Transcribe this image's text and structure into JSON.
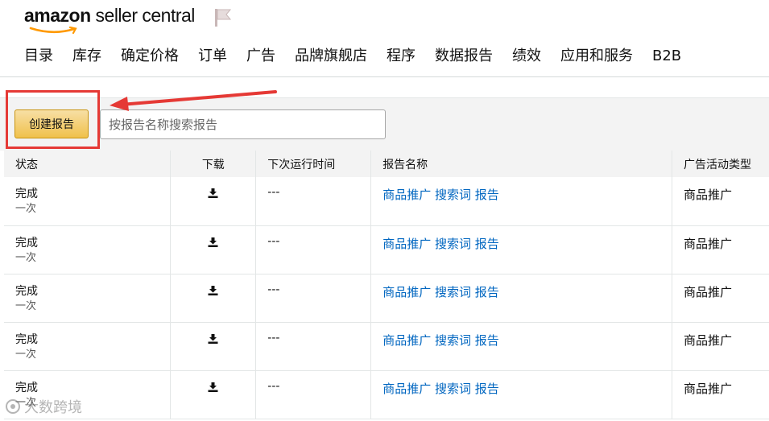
{
  "header": {
    "logo_bold": "amazon",
    "logo_rest": " seller central",
    "logo_icon": "amazon-smile-icon",
    "flag_icon": "flag-icon"
  },
  "nav": {
    "items": [
      "目录",
      "库存",
      "确定价格",
      "订单",
      "广告",
      "品牌旗舰店",
      "程序",
      "数据报告",
      "绩效",
      "应用和服务",
      "B2B"
    ]
  },
  "toolbar": {
    "create_label": "创建报告",
    "search_placeholder": "按报告名称搜索报告",
    "search_value": ""
  },
  "table": {
    "columns": [
      "状态",
      "下载",
      "下次运行时间",
      "报告名称",
      "广告活动类型"
    ],
    "rows": [
      {
        "status": "完成",
        "frequency": "一次",
        "download_icon": "download-icon",
        "next_run": "---",
        "report_name": "商品推广 搜索词 报告",
        "campaign_type": "商品推广"
      },
      {
        "status": "完成",
        "frequency": "一次",
        "download_icon": "download-icon",
        "next_run": "---",
        "report_name": "商品推广 搜索词 报告",
        "campaign_type": "商品推广"
      },
      {
        "status": "完成",
        "frequency": "一次",
        "download_icon": "download-icon",
        "next_run": "---",
        "report_name": "商品推广 搜索词 报告",
        "campaign_type": "商品推广"
      },
      {
        "status": "完成",
        "frequency": "一次",
        "download_icon": "download-icon",
        "next_run": "---",
        "report_name": "商品推广 搜索词 报告",
        "campaign_type": "商品推广"
      },
      {
        "status": "完成",
        "frequency": "一次",
        "download_icon": "download-icon",
        "next_run": "---",
        "report_name": "商品推广 搜索词 报告",
        "campaign_type": "商品推广"
      }
    ]
  },
  "watermark": {
    "text": "大数跨境"
  },
  "colors": {
    "accent_button": "#f0c14b",
    "link": "#0066c0",
    "highlight": "#e53935"
  }
}
